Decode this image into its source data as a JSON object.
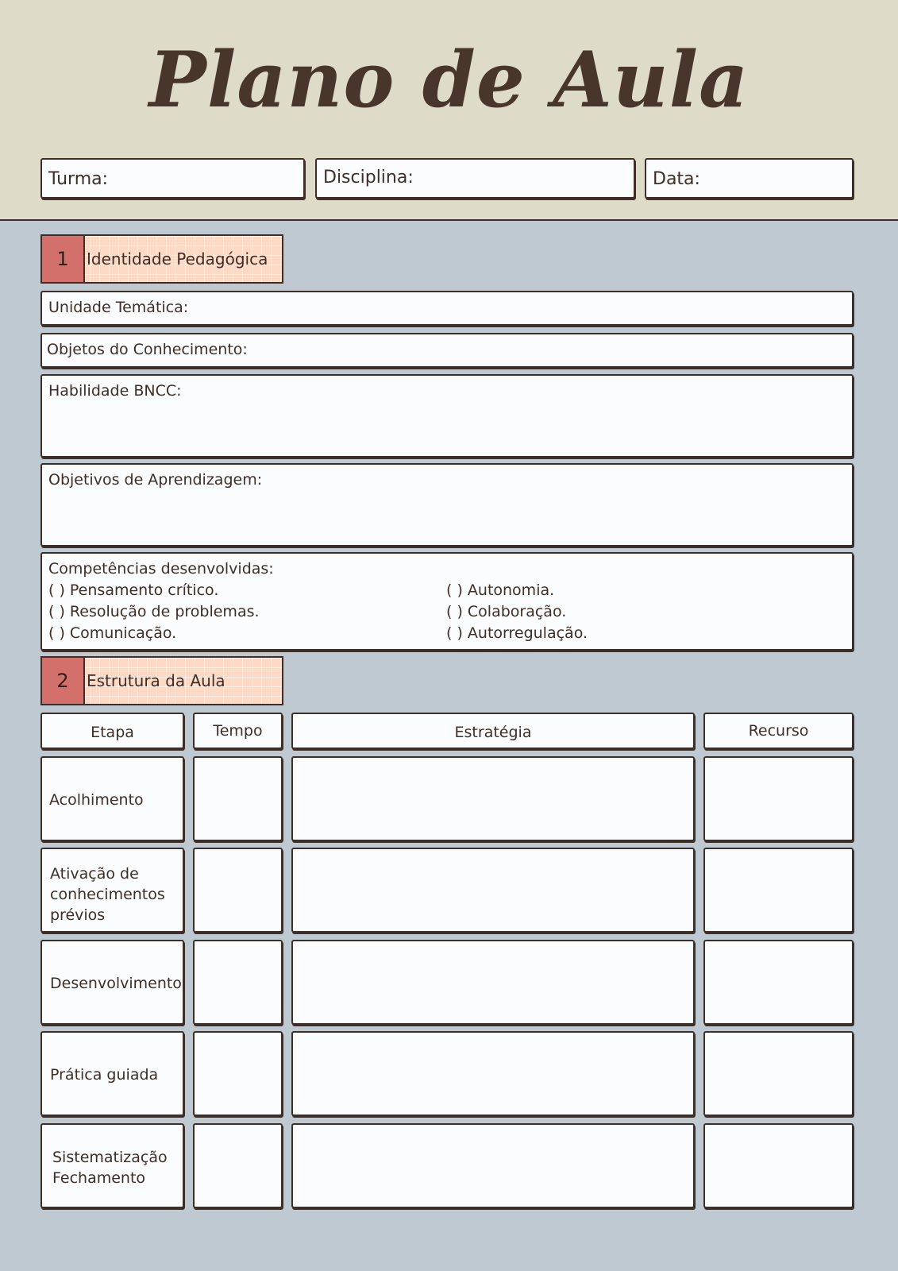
{
  "header": {
    "title": "Plano de Aula",
    "fields": {
      "turma": "Turma:",
      "disciplina": "Disciplina:",
      "data": "Data:"
    }
  },
  "section1": {
    "number": "1",
    "title": "Identidade Pedagógica",
    "unidade_tematica": "Unidade Temática:",
    "objetos_conhecimento": "Objetos do Conhecimento:",
    "habilidade_bncc": "Habilidade BNCC:",
    "objetivos_aprendizagem": "Objetivos de Aprendizagem:",
    "competencias": {
      "title": "Competências desenvolvidas:",
      "left": [
        "(    ) Pensamento crítico.",
        "(    ) Resolução de problemas.",
        "(    ) Comunicação."
      ],
      "right": [
        "(    ) Autonomia.",
        "(    ) Colaboração.",
        "(    ) Autorregulação."
      ]
    }
  },
  "section2": {
    "number": "2",
    "title": "Estrutura da Aula",
    "columns": {
      "etapa": "Etapa",
      "tempo": "Tempo",
      "estrategia": "Estratégia",
      "recurso": "Recurso"
    },
    "rows": [
      {
        "line1": "Acolhimento",
        "line2": "",
        "line3": ""
      },
      {
        "line1": "Ativação de",
        "line2": "conhecimentos",
        "line3": "prévios"
      },
      {
        "line1": "Desenvolvimento",
        "line2": "",
        "line3": ""
      },
      {
        "line1": "Prática guiada",
        "line2": "",
        "line3": ""
      },
      {
        "line1": "Sistematização",
        "line2": "Fechamento",
        "line3": ""
      }
    ]
  },
  "colors": {
    "header_bg": "#dedbc9",
    "page_bg": "#bfc9d2",
    "section_number_bg": "#d4706b",
    "section_title_bg": "#fdd9c6",
    "ink": "#3d2f27"
  }
}
